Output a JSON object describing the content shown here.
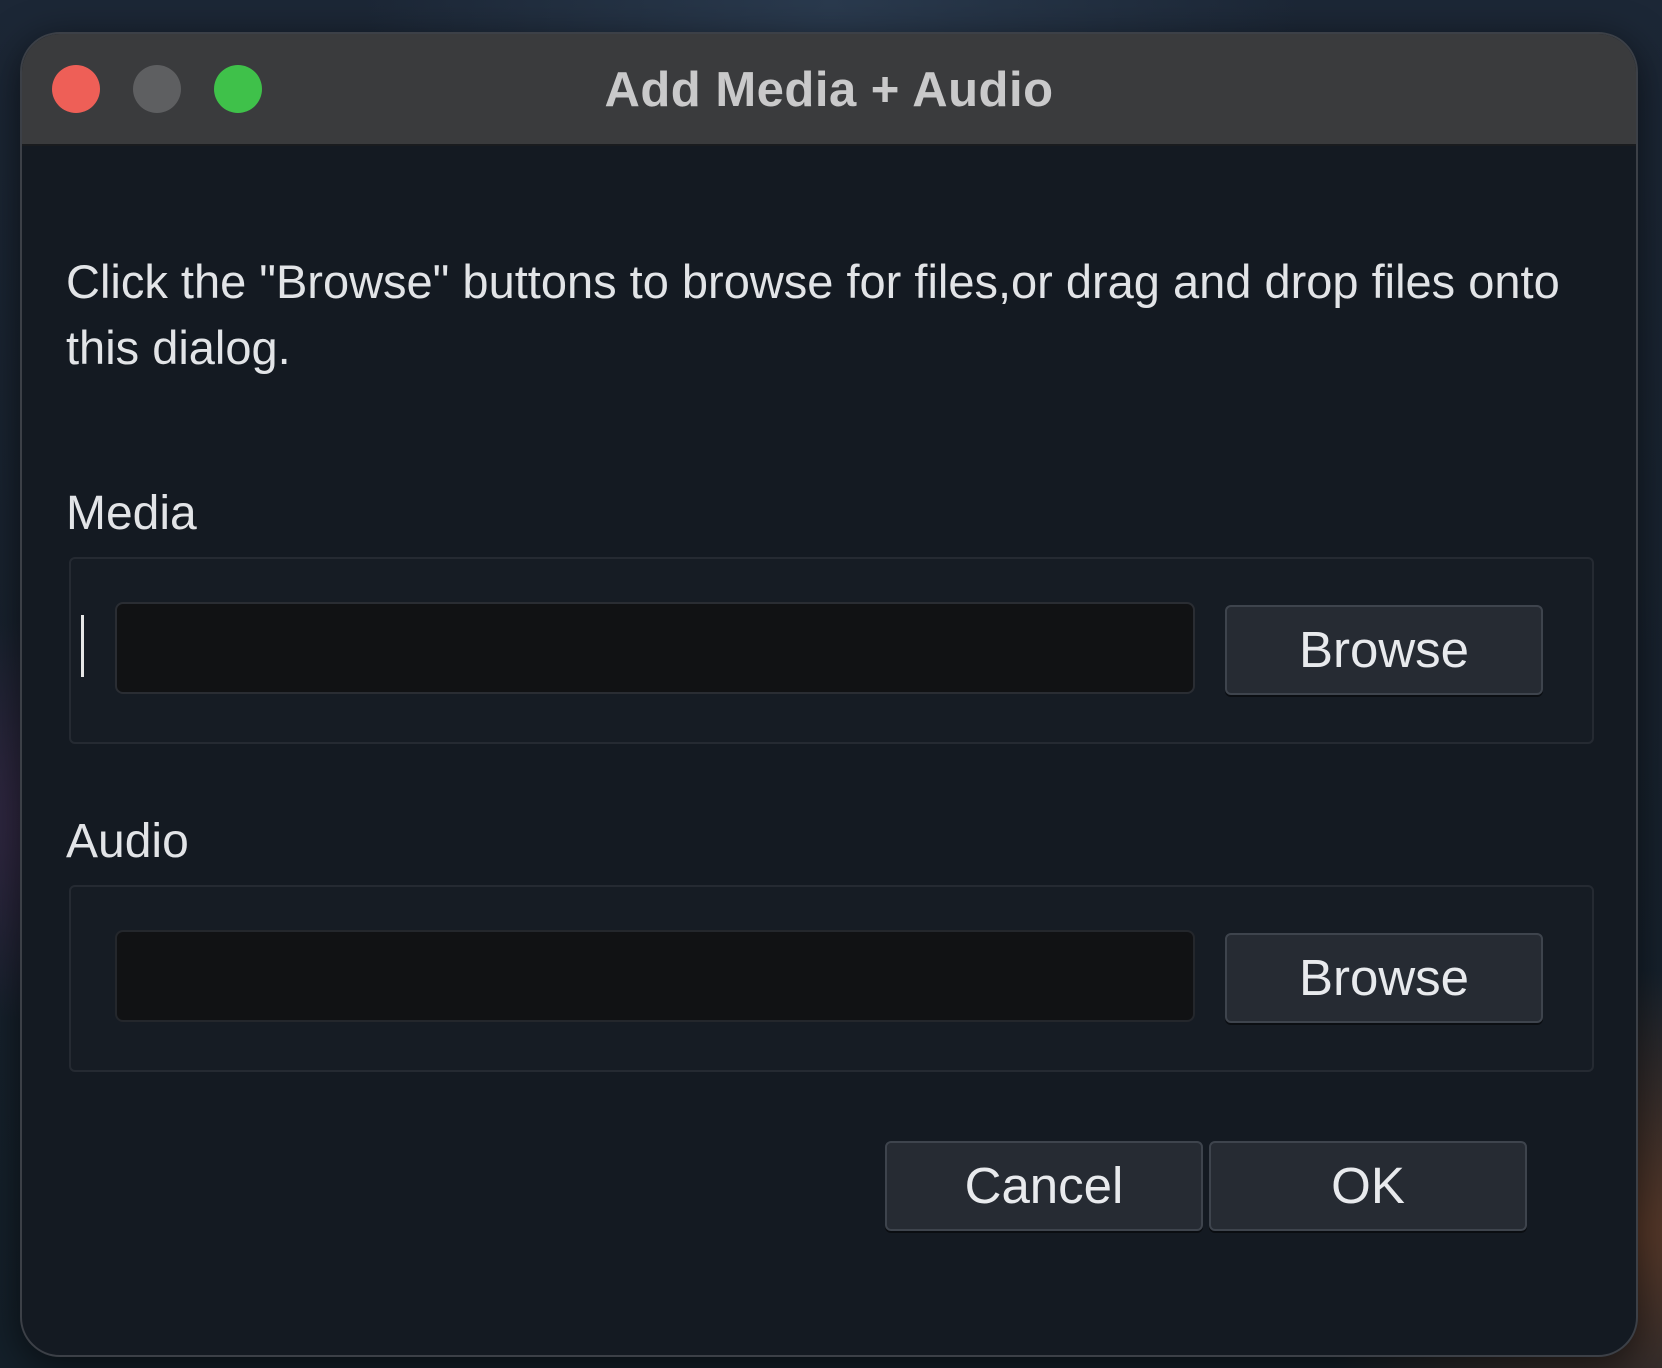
{
  "dialog": {
    "title": "Add Media + Audio",
    "instructions": "Click the \"Browse\" buttons to browse for files,or drag and drop files onto this dialog."
  },
  "media": {
    "label": "Media",
    "value": "",
    "browse_label": "Browse"
  },
  "audio": {
    "label": "Audio",
    "value": "",
    "browse_label": "Browse"
  },
  "footer": {
    "cancel_label": "Cancel",
    "ok_label": "OK"
  },
  "colors": {
    "close": "#ee5f57",
    "minimize": "#5e5f61",
    "zoom": "#3fc14a",
    "window_bg": "#141a22",
    "titlebar_bg": "#3a3b3d"
  }
}
